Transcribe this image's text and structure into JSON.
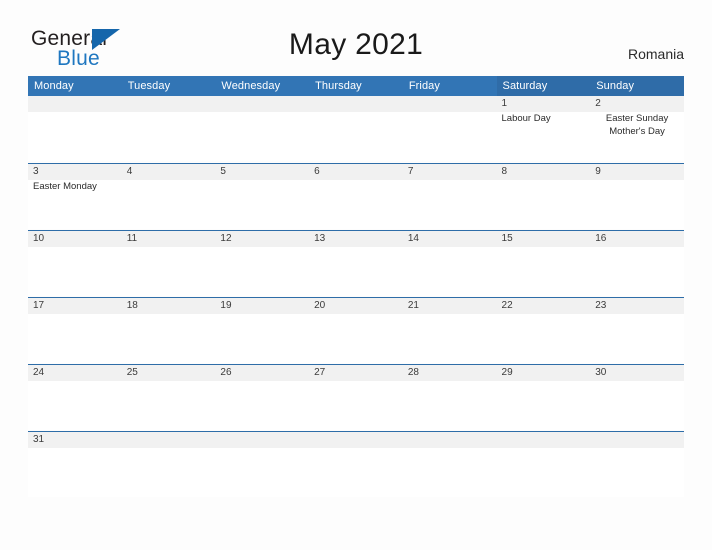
{
  "brand": {
    "name_part1": "General",
    "name_part2": "Blue",
    "flag_icon": "blue-triangle-flag-icon",
    "colors": {
      "dark_text": "#231f20",
      "blue_text": "#1f77c0",
      "flag_blue": "#1566ab"
    }
  },
  "header": {
    "title": "May 2021",
    "country": "Romania"
  },
  "theme": {
    "header_blue": "#3275b5",
    "header_weekend_blue": "#2f6ca8",
    "row_divider_blue": "#2e6da8",
    "date_band_gray": "#f1f1f1",
    "page_background": "#fdfdfd"
  },
  "calendar": {
    "weekdays": [
      {
        "label": "Monday",
        "weekend": false
      },
      {
        "label": "Tuesday",
        "weekend": false
      },
      {
        "label": "Wednesday",
        "weekend": false
      },
      {
        "label": "Thursday",
        "weekend": false
      },
      {
        "label": "Friday",
        "weekend": false
      },
      {
        "label": "Saturday",
        "weekend": true
      },
      {
        "label": "Sunday",
        "weekend": true
      }
    ],
    "weeks": [
      {
        "days": [
          {
            "date": "",
            "events": []
          },
          {
            "date": "",
            "events": []
          },
          {
            "date": "",
            "events": []
          },
          {
            "date": "",
            "events": []
          },
          {
            "date": "",
            "events": []
          },
          {
            "date": "1",
            "events": [
              "Labour Day"
            ]
          },
          {
            "date": "2",
            "events": [
              "Easter Sunday",
              "Mother's Day"
            ]
          }
        ]
      },
      {
        "days": [
          {
            "date": "3",
            "events": [
              "Easter Monday"
            ]
          },
          {
            "date": "4",
            "events": []
          },
          {
            "date": "5",
            "events": []
          },
          {
            "date": "6",
            "events": []
          },
          {
            "date": "7",
            "events": []
          },
          {
            "date": "8",
            "events": []
          },
          {
            "date": "9",
            "events": []
          }
        ]
      },
      {
        "days": [
          {
            "date": "10",
            "events": []
          },
          {
            "date": "11",
            "events": []
          },
          {
            "date": "12",
            "events": []
          },
          {
            "date": "13",
            "events": []
          },
          {
            "date": "14",
            "events": []
          },
          {
            "date": "15",
            "events": []
          },
          {
            "date": "16",
            "events": []
          }
        ]
      },
      {
        "days": [
          {
            "date": "17",
            "events": []
          },
          {
            "date": "18",
            "events": []
          },
          {
            "date": "19",
            "events": []
          },
          {
            "date": "20",
            "events": []
          },
          {
            "date": "21",
            "events": []
          },
          {
            "date": "22",
            "events": []
          },
          {
            "date": "23",
            "events": []
          }
        ]
      },
      {
        "days": [
          {
            "date": "24",
            "events": []
          },
          {
            "date": "25",
            "events": []
          },
          {
            "date": "26",
            "events": []
          },
          {
            "date": "27",
            "events": []
          },
          {
            "date": "28",
            "events": []
          },
          {
            "date": "29",
            "events": []
          },
          {
            "date": "30",
            "events": []
          }
        ]
      },
      {
        "days": [
          {
            "date": "31",
            "events": []
          },
          {
            "date": "",
            "events": []
          },
          {
            "date": "",
            "events": []
          },
          {
            "date": "",
            "events": []
          },
          {
            "date": "",
            "events": []
          },
          {
            "date": "",
            "events": []
          },
          {
            "date": "",
            "events": []
          }
        ]
      }
    ]
  }
}
